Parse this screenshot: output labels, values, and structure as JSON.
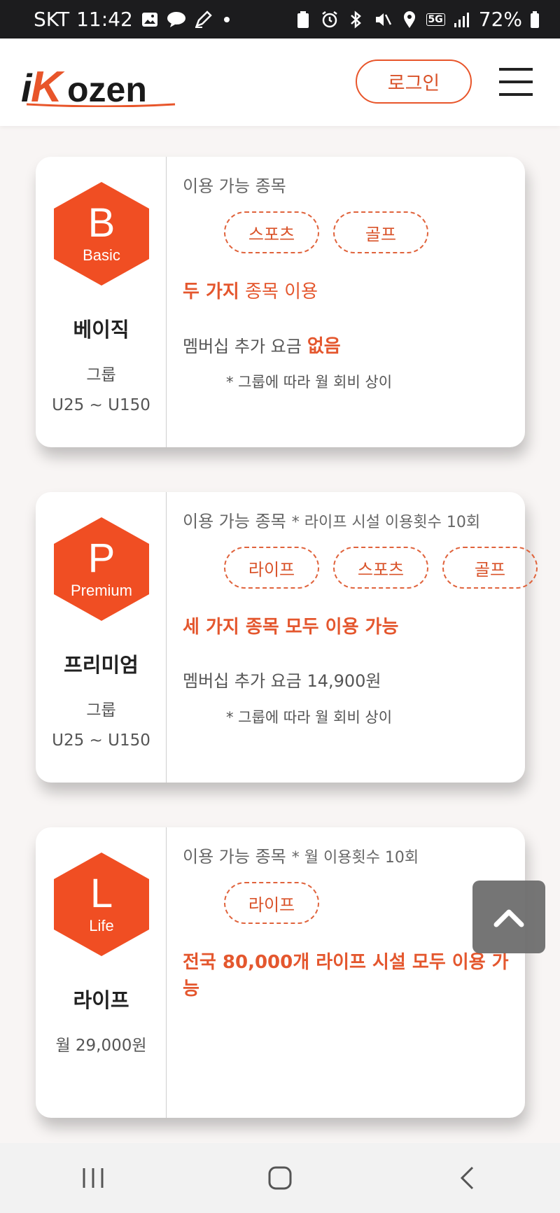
{
  "status_bar": {
    "carrier": "SKT",
    "time": "11:42",
    "network": "5G",
    "battery": "72%"
  },
  "header": {
    "logo_text": "iKozen",
    "login_label": "로그인"
  },
  "plans": [
    {
      "letter": "B",
      "tier": "Basic",
      "name": "베이직",
      "sub1": "그룹",
      "sub2": "U25 ~ U150",
      "avail_label": "이용 가능 종목",
      "avail_note": "",
      "chips": [
        "스포츠",
        "골프"
      ],
      "headline_bold": "두 가지",
      "headline_rest": " 종목 이용",
      "fee_label": "멤버십 추가 요금",
      "fee_value": "없음",
      "fee_note": "* 그룹에 따라 월 회비 상이"
    },
    {
      "letter": "P",
      "tier": "Premium",
      "name": "프리미엄",
      "sub1": "그룹",
      "sub2": "U25 ~ U150",
      "avail_label": "이용 가능 종목",
      "avail_note": "* 라이프 시설 이용횟수 10회",
      "chips": [
        "라이프",
        "스포츠",
        "골프"
      ],
      "headline_bold": "세 가지 종목 모두 이용 가능",
      "headline_rest": "",
      "fee_label": "멤버십 추가 요금 14,900원",
      "fee_value": "",
      "fee_note": "* 그룹에 따라 월 회비 상이"
    },
    {
      "letter": "L",
      "tier": "Life",
      "name": "라이프",
      "sub1": "월 29,000원",
      "sub2": "",
      "avail_label": "이용 가능 종목",
      "avail_note": "* 월 이용횟수 10회",
      "chips": [
        "라이프"
      ],
      "headline_line1": "전국 80,000개 라이프 시설 모두 이용 가",
      "headline_line2": "능"
    }
  ],
  "colors": {
    "brand": "#e8552a",
    "hexagon": "#f04e23",
    "text_dark": "#222222"
  }
}
